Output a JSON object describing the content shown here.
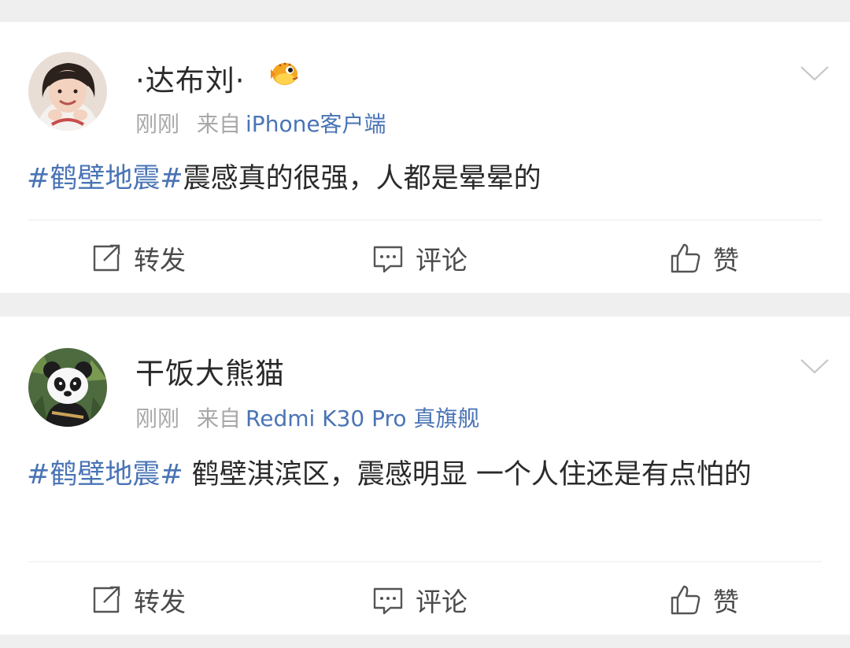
{
  "posts": [
    {
      "username": "·达布刘·",
      "time": "刚刚",
      "from_label": "来自",
      "source": "iPhone客户端",
      "hashtag": "#鹤壁地震#",
      "body": "震感真的很强，人都是晕晕的",
      "actions": {
        "repost": "转发",
        "comment": "评论",
        "like": "赞"
      },
      "avatar_icon": "girl-portrait-avatar",
      "badge_icon": "pufferfish-badge-icon"
    },
    {
      "username": "干饭大熊猫",
      "time": "刚刚",
      "from_label": "来自",
      "source": "Redmi K30 Pro 真旗舰",
      "hashtag": "#鹤壁地震#",
      "body": " 鹤壁淇滨区，震感明显 一个人住还是有点怕的",
      "actions": {
        "repost": "转发",
        "comment": "评论",
        "like": "赞"
      },
      "avatar_icon": "panda-avatar"
    }
  ],
  "colors": {
    "link": "#4a74b5",
    "meta": "#a8a8a8",
    "text": "#2a2a2a",
    "page_bg": "#efefef"
  }
}
